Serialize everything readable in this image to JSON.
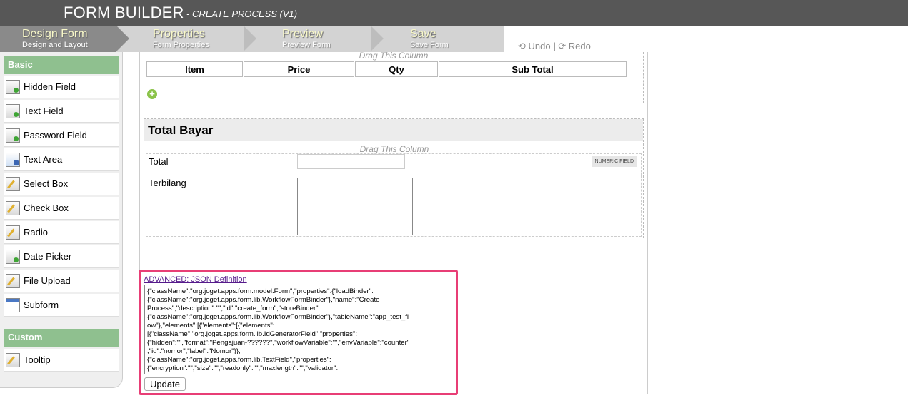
{
  "header": {
    "title": "FORM BUILDER",
    "subtitle": "- CREATE PROCESS (V1)"
  },
  "steps": [
    {
      "label": "Design Form",
      "sub": "Design and Layout"
    },
    {
      "label": "Properties",
      "sub": "Form Properties"
    },
    {
      "label": "Preview",
      "sub": "Preview Form"
    },
    {
      "label": "Save",
      "sub": "Save Form"
    }
  ],
  "toolbar": {
    "undo": "Undo",
    "separator": "|",
    "redo": "Redo"
  },
  "palette": {
    "basic_label": "Basic",
    "basic_items": [
      "Hidden Field",
      "Text Field",
      "Password Field",
      "Text Area",
      "Select Box",
      "Check Box",
      "Radio",
      "Date Picker",
      "File Upload",
      "Subform"
    ],
    "custom_label": "Custom",
    "custom_items": [
      "Tooltip"
    ]
  },
  "canvas": {
    "drag_text": "Drag This Column",
    "grid_columns": [
      "Item",
      "Price",
      "Qty",
      "Sub Total"
    ],
    "add_symbol": "+",
    "section_title": "Total Bayar",
    "fields": [
      {
        "label": "Total",
        "badge": "NUMERIC FIELD"
      },
      {
        "label": "Terbilang"
      }
    ]
  },
  "advanced": {
    "link": "ADVANCED: JSON Definition",
    "json": "{\"className\":\"org.joget.apps.form.model.Form\",\"properties\":{\"loadBinder\":\n{\"className\":\"org.joget.apps.form.lib.WorkflowFormBinder\"},\"name\":\"Create\nProcess\",\"description\":\"\",\"id\":\"create_form\",\"storeBinder\":\n{\"className\":\"org.joget.apps.form.lib.WorkflowFormBinder\"},\"tableName\":\"app_test_fl\now\"},\"elements\":[{\"elements\":[{\"elements\":\n[{\"className\":\"org.joget.apps.form.lib.IdGeneratorField\",\"properties\":\n{\"hidden\":\"\",\"format\":\"Pengajuan-??????\",\"workflowVariable\":\"\",\"envVariable\":\"counter\"\n,\"id\":\"nomor\",\"label\":\"Nomor\"}},\n{\"className\":\"org.joget.apps.form.lib.TextField\",\"properties\":\n{\"encryption\":\"\",\"size\":\"\",\"readonly\":\"\",\"maxlength\":\"\",\"validator\":",
    "update": "Update"
  },
  "colors": {
    "header": "#575757",
    "accent": "#8fc08f",
    "highlight": "#e83e76"
  }
}
